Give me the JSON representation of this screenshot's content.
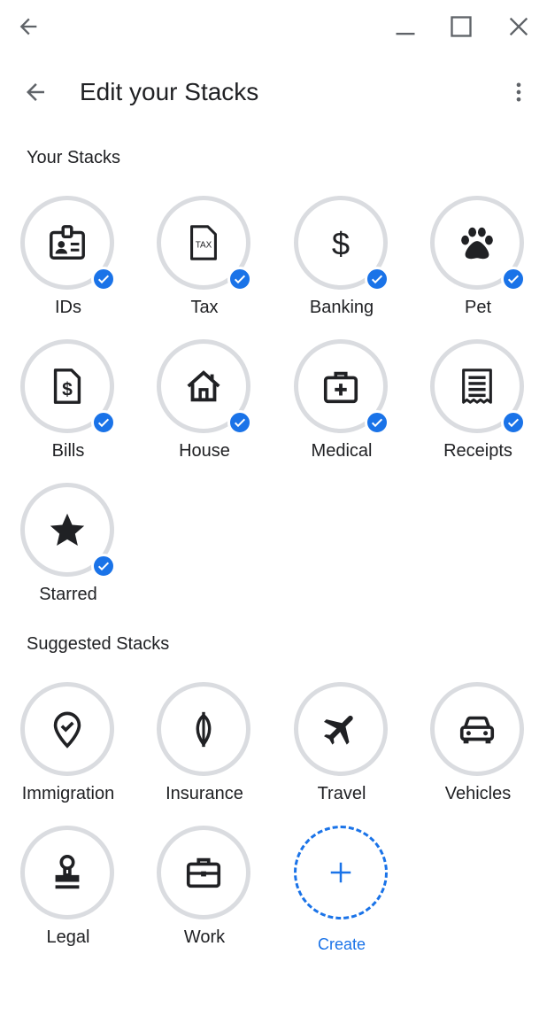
{
  "header": {
    "title": "Edit your Stacks"
  },
  "sections": {
    "your_stacks": "Your Stacks",
    "suggested_stacks": "Suggested Stacks"
  },
  "your_stacks": [
    {
      "label": "IDs",
      "icon": "id-badge-icon",
      "selected": true
    },
    {
      "label": "Tax",
      "icon": "tax-document-icon",
      "selected": true
    },
    {
      "label": "Banking",
      "icon": "dollar-icon",
      "selected": true
    },
    {
      "label": "Pet",
      "icon": "paw-icon",
      "selected": true
    },
    {
      "label": "Bills",
      "icon": "bill-icon",
      "selected": true
    },
    {
      "label": "House",
      "icon": "house-icon",
      "selected": true
    },
    {
      "label": "Medical",
      "icon": "medical-kit-icon",
      "selected": true
    },
    {
      "label": "Receipts",
      "icon": "receipt-icon",
      "selected": true
    },
    {
      "label": "Starred",
      "icon": "star-icon",
      "selected": true
    }
  ],
  "suggested_stacks": [
    {
      "label": "Immigration",
      "icon": "location-check-icon"
    },
    {
      "label": "Insurance",
      "icon": "umbrella-icon"
    },
    {
      "label": "Travel",
      "icon": "airplane-icon"
    },
    {
      "label": "Vehicles",
      "icon": "car-icon"
    },
    {
      "label": "Legal",
      "icon": "stamp-icon"
    },
    {
      "label": "Work",
      "icon": "briefcase-icon"
    }
  ],
  "create": {
    "label": "Create",
    "icon": "plus-icon"
  },
  "colors": {
    "accent": "#1a73e8",
    "ring": "#dadce0",
    "text": "#202124"
  }
}
